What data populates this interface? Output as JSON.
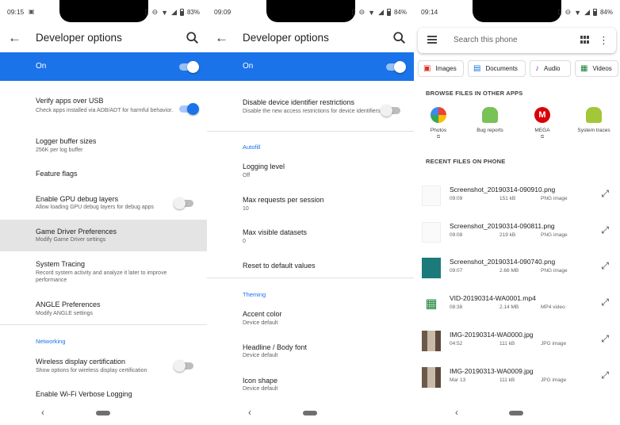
{
  "screen1": {
    "status": {
      "time": "09:15",
      "battery": "83%"
    },
    "title": "Developer options",
    "master": {
      "label": "On",
      "checked": true
    },
    "rows": [
      {
        "title": "Verify apps over USB",
        "subtitle": "Check apps installed via ADB/ADT for harmful behavior.",
        "toggle": "on"
      },
      {
        "title": "Logger buffer sizes",
        "subtitle": "256K per log buffer"
      },
      {
        "title": "Feature flags",
        "subtitle": ""
      },
      {
        "title": "Enable GPU debug layers",
        "subtitle": "Allow loading GPU debug layers for debug apps",
        "toggle": "off"
      },
      {
        "title": "Game Driver Preferences",
        "subtitle": "Modify Game Driver settings",
        "highlighted": true
      },
      {
        "title": "System Tracing",
        "subtitle": "Record system activity and analyze it later to improve performance"
      },
      {
        "title": "ANGLE Preferences",
        "subtitle": "Modify ANGLE settings"
      }
    ],
    "section": "Networking",
    "net_rows": [
      {
        "title": "Wireless display certification",
        "subtitle": "Show options for wireless display certification",
        "toggle": "off"
      },
      {
        "title": "Enable Wi-Fi Verbose Logging",
        "subtitle": ""
      }
    ]
  },
  "screen2": {
    "status": {
      "time": "09:09",
      "battery": "84%"
    },
    "title": "Developer options",
    "master": {
      "label": "On",
      "checked": true
    },
    "rows": [
      {
        "title": "Disable device identifier restrictions",
        "subtitle": "Disable the new access restrictions for device identifiers",
        "toggle": "off"
      }
    ],
    "autofill_section": "Autofill",
    "autofill_rows": [
      {
        "title": "Logging level",
        "subtitle": "Off"
      },
      {
        "title": "Max requests per session",
        "subtitle": "10"
      },
      {
        "title": "Max visible datasets",
        "subtitle": "0"
      },
      {
        "title": "Reset to default values",
        "subtitle": ""
      }
    ],
    "theming_section": "Theming",
    "theming_rows": [
      {
        "title": "Accent color",
        "subtitle": "Device default"
      },
      {
        "title": "Headline / Body font",
        "subtitle": "Device default"
      },
      {
        "title": "Icon shape",
        "subtitle": "Device default"
      }
    ]
  },
  "screen3": {
    "status": {
      "time": "09:14",
      "battery": "84%"
    },
    "search_placeholder": "Search this phone",
    "chips": [
      {
        "label": "Images",
        "icon": "image-icon",
        "color": "#d93025"
      },
      {
        "label": "Documents",
        "icon": "document-icon",
        "color": "#1a73e8"
      },
      {
        "label": "Audio",
        "icon": "music-icon",
        "color": "#9334e6"
      },
      {
        "label": "Videos",
        "icon": "video-icon",
        "color": "#188038"
      }
    ],
    "browse_title": "BROWSE FILES IN OTHER APPS",
    "apps": [
      {
        "label": "Photos",
        "icon": "photos-icon"
      },
      {
        "label": "Bug reports",
        "icon": "android-icon"
      },
      {
        "label": "MEGA",
        "icon": "mega-icon"
      },
      {
        "label": "System traces",
        "icon": "android-icon"
      }
    ],
    "recent_title": "RECENT FILES ON PHONE",
    "files": [
      {
        "name": "Screenshot_20190314-090910.png",
        "time": "09:09",
        "size": "151 kB",
        "type": "PNG image"
      },
      {
        "name": "Screenshot_20190314-090811.png",
        "time": "09:08",
        "size": "219 kB",
        "type": "PNG image"
      },
      {
        "name": "Screenshot_20190314-090740.png",
        "time": "09:07",
        "size": "2.66 MB",
        "type": "PNG image"
      },
      {
        "name": "VID-20190314-WA0001.mp4",
        "time": "08:38",
        "size": "2.14 MB",
        "type": "MP4 video"
      },
      {
        "name": "IMG-20190314-WA0000.jpg",
        "time": "04:52",
        "size": "111 kB",
        "type": "JPG image"
      },
      {
        "name": "IMG-20190313-WA0009.jpg",
        "time": "Mar 13",
        "size": "111 kB",
        "type": "JPG image"
      }
    ]
  }
}
